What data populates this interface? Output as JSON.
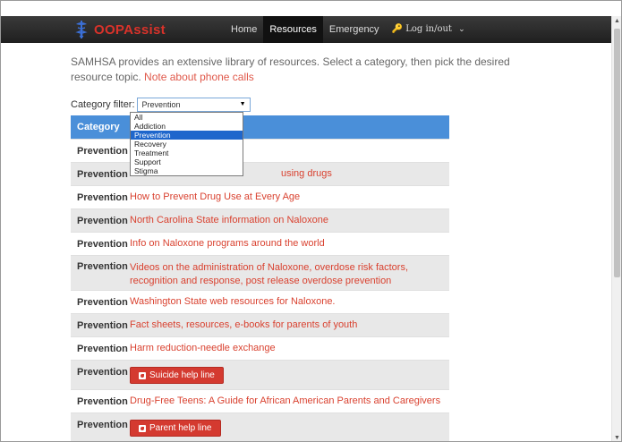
{
  "nav": {
    "brand": "OOPAssist",
    "links": [
      "Home",
      "Resources",
      "Emergency"
    ],
    "login": "Log in/out"
  },
  "intro": {
    "text": "SAMHSA provides an extensive library of resources. Select a category, then pick the desired resource topic.",
    "note_link": "Note about phone calls"
  },
  "filter": {
    "label": "Category filter:",
    "selected": "Prevention",
    "options": [
      "All",
      "Addiction",
      "Prevention",
      "Recovery",
      "Treatment",
      "Support",
      "Stigma"
    ]
  },
  "table": {
    "header": "Category",
    "rows": [
      {
        "category": "Prevention",
        "resource": ""
      },
      {
        "category": "Prevention",
        "resource": "using drugs"
      },
      {
        "category": "Prevention",
        "resource": "How to Prevent Drug Use at Every Age"
      },
      {
        "category": "Prevention",
        "resource": "North Carolina State information on Naloxone"
      },
      {
        "category": "Prevention",
        "resource": "Info on Naloxone programs around the world"
      },
      {
        "category": "Prevention",
        "resource": "Videos on the administration of Naloxone, overdose risk factors, recognition and response, post release overdose prevention"
      },
      {
        "category": "Prevention",
        "resource": "Washington State web resources for Naloxone."
      },
      {
        "category": "Prevention",
        "resource": "Fact sheets, resources, e-books for parents of youth"
      },
      {
        "category": "Prevention",
        "resource": "Harm reduction-needle exchange"
      },
      {
        "category": "Prevention",
        "button": "Suicide help line"
      },
      {
        "category": "Prevention",
        "resource": "Drug-Free Teens: A Guide for African American Parents and Caregivers"
      },
      {
        "category": "Prevention",
        "button": "Parent help line"
      }
    ]
  },
  "colors": {
    "accent_red": "#d9412f",
    "header_blue": "#4a8fd9",
    "selected_blue": "#1e66cc"
  }
}
